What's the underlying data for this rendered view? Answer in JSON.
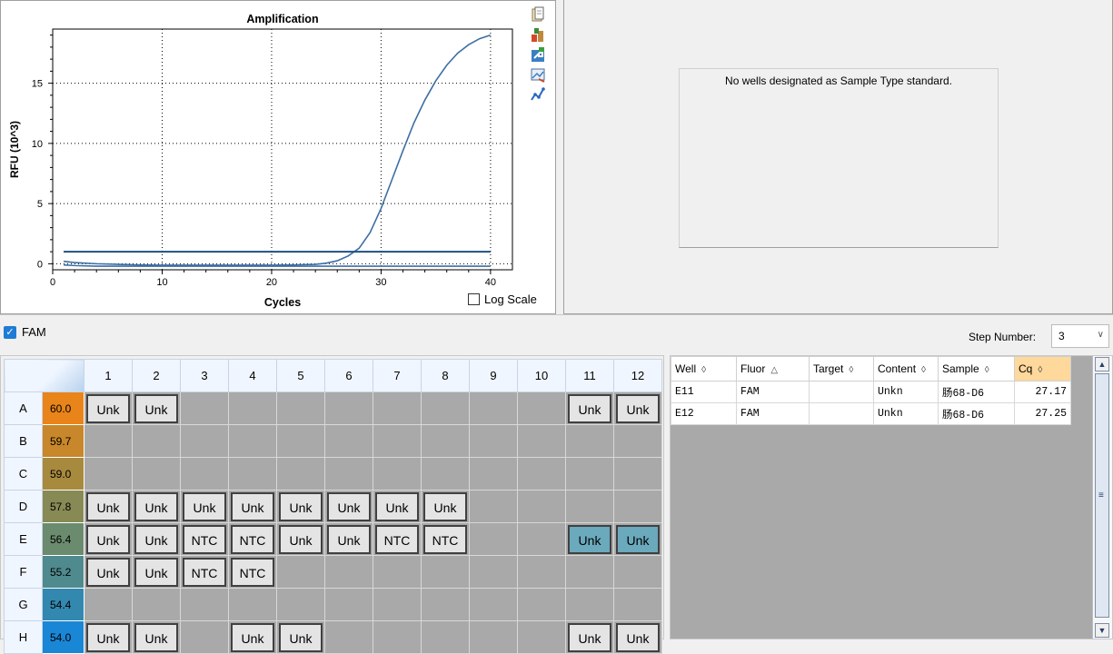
{
  "chart_data": {
    "type": "line",
    "title": "Amplification",
    "xlabel": "Cycles",
    "ylabel": "RFU (10^3)",
    "xlim": [
      0,
      42
    ],
    "ylim": [
      -0.5,
      19.5
    ],
    "xticks": [
      0,
      10,
      20,
      30,
      40
    ],
    "yticks": [
      0,
      5,
      10,
      15
    ],
    "grid": true,
    "series": [
      {
        "color": "#3d6fa3",
        "x": [
          1,
          2,
          4,
          6,
          8,
          10,
          12,
          14,
          16,
          18,
          20,
          22,
          24,
          25,
          26,
          27,
          28,
          29,
          30,
          31,
          32,
          33,
          34,
          35,
          36,
          37,
          38,
          39,
          40
        ],
        "y": [
          0.2,
          0.1,
          0.0,
          -0.05,
          -0.1,
          -0.12,
          -0.12,
          -0.12,
          -0.12,
          -0.12,
          -0.12,
          -0.1,
          -0.05,
          0.05,
          0.25,
          0.65,
          1.3,
          2.6,
          4.6,
          7.0,
          9.4,
          11.7,
          13.6,
          15.2,
          16.5,
          17.5,
          18.2,
          18.7,
          19.0
        ]
      },
      {
        "color": "#3d6fa3",
        "x": [
          1,
          2,
          4,
          8,
          14,
          20,
          26,
          28,
          30,
          34,
          40
        ],
        "y": [
          -0.1,
          -0.15,
          -0.2,
          -0.2,
          -0.2,
          -0.2,
          -0.2,
          -0.2,
          -0.2,
          -0.2,
          -0.2
        ]
      },
      {
        "color": "#1f4f86",
        "x": [
          1,
          40
        ],
        "y": [
          1.0,
          1.0
        ]
      }
    ]
  },
  "chart_tools": [
    "copy-icon",
    "export-icon",
    "share-icon",
    "image-icon",
    "analysis-icon"
  ],
  "log_scale": {
    "label": "Log Scale",
    "checked": false
  },
  "std_curve": {
    "message": "No wells designated as Sample Type standard."
  },
  "fluor": {
    "label": "FAM",
    "checked": true
  },
  "step": {
    "label": "Step Number:",
    "value": "3"
  },
  "plate": {
    "columns": [
      "1",
      "2",
      "3",
      "4",
      "5",
      "6",
      "7",
      "8",
      "9",
      "10",
      "11",
      "12"
    ],
    "rows": [
      {
        "label": "A",
        "temp": "60.0",
        "temp_color": "#e8841a",
        "wells": [
          "Unk",
          "Unk",
          "",
          "",
          "",
          "",
          "",
          "",
          "",
          "",
          "Unk",
          "Unk"
        ]
      },
      {
        "label": "B",
        "temp": "59.7",
        "temp_color": "#c7872a",
        "wells": [
          "",
          "",
          "",
          "",
          "",
          "",
          "",
          "",
          "",
          "",
          "",
          ""
        ]
      },
      {
        "label": "C",
        "temp": "59.0",
        "temp_color": "#a88a3e",
        "wells": [
          "",
          "",
          "",
          "",
          "",
          "",
          "",
          "",
          "",
          "",
          "",
          ""
        ]
      },
      {
        "label": "D",
        "temp": "57.8",
        "temp_color": "#888a55",
        "wells": [
          "Unk",
          "Unk",
          "Unk",
          "Unk",
          "Unk",
          "Unk",
          "Unk",
          "Unk",
          "",
          "",
          "",
          ""
        ]
      },
      {
        "label": "E",
        "temp": "56.4",
        "temp_color": "#6a8b6e",
        "wells": [
          "Unk",
          "Unk",
          "NTC",
          "NTC",
          "Unk",
          "Unk",
          "NTC",
          "NTC",
          "",
          "",
          "Unk",
          "Unk"
        ]
      },
      {
        "label": "F",
        "temp": "55.2",
        "temp_color": "#4f8a8e",
        "wells": [
          "Unk",
          "Unk",
          "NTC",
          "NTC",
          "",
          "",
          "",
          "",
          "",
          "",
          "",
          ""
        ]
      },
      {
        "label": "G",
        "temp": "54.4",
        "temp_color": "#3388b0",
        "wells": [
          "",
          "",
          "",
          "",
          "",
          "",
          "",
          "",
          "",
          "",
          "",
          ""
        ]
      },
      {
        "label": "H",
        "temp": "54.0",
        "temp_color": "#1a86d6",
        "wells": [
          "Unk",
          "Unk",
          "",
          "Unk",
          "Unk",
          "",
          "",
          "",
          "",
          "",
          "Unk",
          "Unk"
        ]
      }
    ],
    "selected": [
      "E11",
      "E12"
    ]
  },
  "results": {
    "headers": [
      {
        "label": "Well",
        "sort": "◊"
      },
      {
        "label": "Fluor",
        "sort": "△"
      },
      {
        "label": "Target",
        "sort": "◊"
      },
      {
        "label": "Content",
        "sort": "◊"
      },
      {
        "label": "Sample",
        "sort": "◊"
      },
      {
        "label": "Cq",
        "sort": "◊"
      }
    ],
    "rows": [
      {
        "well": "E11",
        "fluor": "FAM",
        "target": "",
        "content": "Unkn",
        "sample": "肠68-D6",
        "cq": "27.17"
      },
      {
        "well": "E12",
        "fluor": "FAM",
        "target": "",
        "content": "Unkn",
        "sample": "肠68-D6",
        "cq": "27.25"
      }
    ]
  }
}
